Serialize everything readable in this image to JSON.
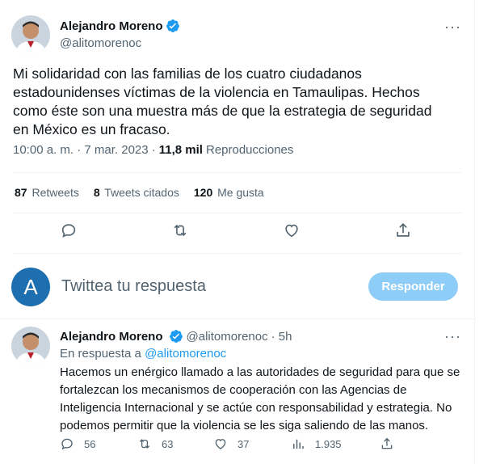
{
  "main_tweet": {
    "author_name": "Alejandro Moreno",
    "author_handle": "@alitomorenoc",
    "text": "Mi solidaridad con las familias de los cuatro ciudadanos estadounidenses víctimas de la violencia en Tamaulipas. Hechos como éste son una muestra más de que la estrategia de seguridad en México es un fracaso.",
    "time": "10:00 a. m. · 7 mar. 2023 ·",
    "views_count": "11,8 mil",
    "views_label": "Reproducciones",
    "retweets_count": "87",
    "retweets_label": "Retweets",
    "quotes_count": "8",
    "quotes_label": "Tweets citados",
    "likes_count": "120",
    "likes_label": "Me gusta",
    "more_icon": "more-dots-icon",
    "verified_icon": "verified-badge-icon"
  },
  "reply_box": {
    "avatar_letter": "A",
    "placeholder": "Twittea tu respuesta",
    "button_label": "Responder",
    "button_color": "#8ecdf8"
  },
  "reply_tweet": {
    "author_name": "Alejandro Moreno",
    "author_handle": "@alitomorenoc",
    "age": "· 5h",
    "in_reply_prefix": "En respuesta a",
    "in_reply_handle": "@alitomorenoc",
    "text": "Hacemos un enérgico llamado a las autoridades de seguridad para que se fortalezcan los mecanismos de cooperación con las Agencias de Inteligencia Internacional y se actúe con responsabilidad y estrategia. No podemos permitir que la violencia se les siga saliendo de las manos.",
    "replies": "56",
    "retweets": "63",
    "likes": "37",
    "views": "1.935"
  },
  "colors": {
    "accent": "#1d9bf0",
    "muted": "#536471",
    "divider": "#eff3f4"
  }
}
